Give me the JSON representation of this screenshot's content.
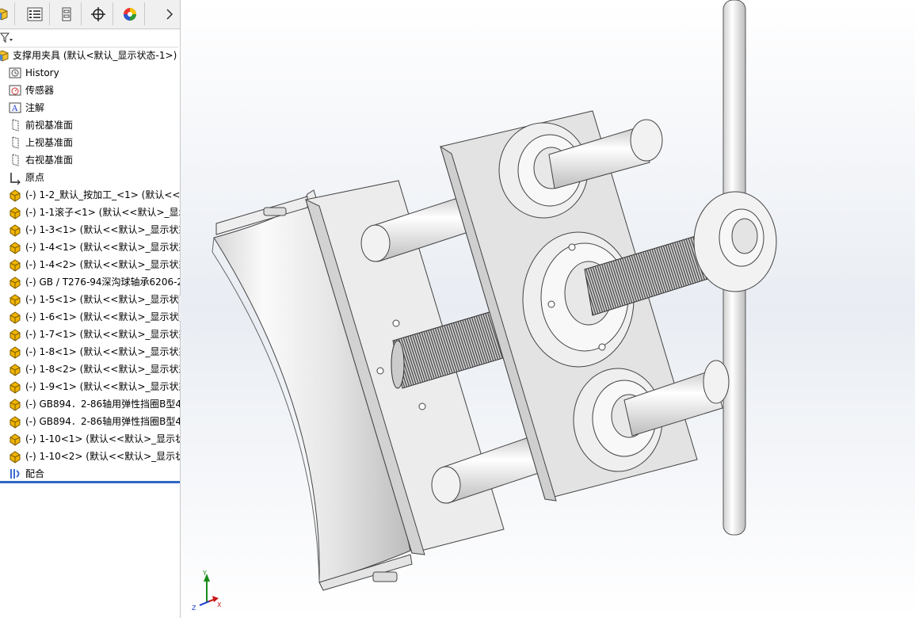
{
  "tree": {
    "root_label": "支撑用夹具  (默认<默认_显示状态-1>)",
    "items": [
      {
        "label": "History",
        "icon": "history-icon",
        "name": "tree-item-history"
      },
      {
        "label": "传感器",
        "icon": "sensor-icon",
        "name": "tree-item-sensors"
      },
      {
        "label": "注解",
        "icon": "annotation-icon",
        "name": "tree-item-annotations"
      },
      {
        "label": "前视基准面",
        "icon": "plane-icon",
        "name": "tree-item-front-plane"
      },
      {
        "label": "上视基准面",
        "icon": "plane-icon",
        "name": "tree-item-top-plane"
      },
      {
        "label": "右视基准面",
        "icon": "plane-icon",
        "name": "tree-item-right-plane"
      },
      {
        "label": "原点",
        "icon": "origin-icon",
        "name": "tree-item-origin"
      },
      {
        "label": "(-) 1-2_默认_按加工_<1> (默认<<默认",
        "icon": "part-icon",
        "name": "tree-item-component"
      },
      {
        "label": "(-) 1-1滚子<1> (默认<<默认>_显示",
        "icon": "part-icon",
        "name": "tree-item-component"
      },
      {
        "label": "(-) 1-3<1> (默认<<默认>_显示状态",
        "icon": "part-icon",
        "name": "tree-item-component"
      },
      {
        "label": "(-) 1-4<1> (默认<<默认>_显示状态",
        "icon": "part-icon",
        "name": "tree-item-component"
      },
      {
        "label": "(-) 1-4<2> (默认<<默认>_显示状态",
        "icon": "part-icon",
        "name": "tree-item-component"
      },
      {
        "label": "(-) GB / T276-94深沟球轴承6206-2",
        "icon": "part-icon",
        "name": "tree-item-component"
      },
      {
        "label": "(-) 1-5<1> (默认<<默认>_显示状态",
        "icon": "part-icon",
        "name": "tree-item-component"
      },
      {
        "label": "(-) 1-6<1> (默认<<默认>_显示状态",
        "icon": "part-icon",
        "name": "tree-item-component"
      },
      {
        "label": "(-) 1-7<1> (默认<<默认>_显示状态",
        "icon": "part-icon",
        "name": "tree-item-component"
      },
      {
        "label": "(-) 1-8<1> (默认<<默认>_显示状态",
        "icon": "part-icon",
        "name": "tree-item-component"
      },
      {
        "label": "(-) 1-8<2> (默认<<默认>_显示状态",
        "icon": "part-icon",
        "name": "tree-item-component"
      },
      {
        "label": "(-) 1-9<1> (默认<<默认>_显示状态",
        "icon": "part-icon",
        "name": "tree-item-component"
      },
      {
        "label": "(-) GB894．2-86轴用弹性挡圈B型4",
        "icon": "part-icon",
        "name": "tree-item-component"
      },
      {
        "label": "(-) GB894．2-86轴用弹性挡圈B型4",
        "icon": "part-icon",
        "name": "tree-item-component"
      },
      {
        "label": "(-) 1-10<1> (默认<<默认>_显示状",
        "icon": "part-icon",
        "name": "tree-item-component"
      },
      {
        "label": "(-) 1-10<2> (默认<<默认>_显示状",
        "icon": "part-icon",
        "name": "tree-item-component"
      },
      {
        "label": "配合",
        "icon": "mates-icon",
        "name": "tree-item-mates"
      }
    ]
  },
  "triad": {
    "y_label": "Y",
    "x_label": "X",
    "z_label": "Z"
  },
  "colors": {
    "accent": "#2f66c4",
    "part_yellow": "#f0b400"
  }
}
